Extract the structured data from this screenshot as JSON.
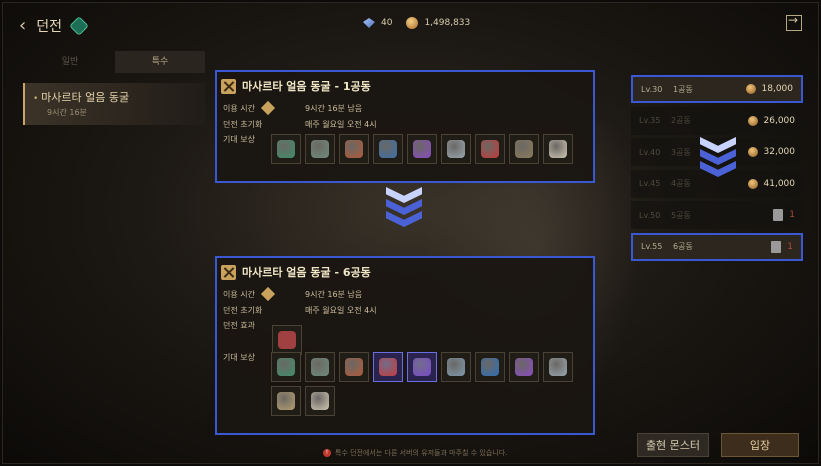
{
  "header": {
    "title": "던전",
    "gem_count": "40",
    "coin_count": "1,498,833"
  },
  "tabs": [
    {
      "label": "일반",
      "active": false
    },
    {
      "label": "특수",
      "active": true
    }
  ],
  "dungeon_list": [
    {
      "name": "마사르타 얼음 동굴",
      "time": "9시간 16분"
    }
  ],
  "panel1": {
    "title": "마사르타 얼음 동굴 - 1공동",
    "rows": [
      {
        "label": "이용 시간",
        "value": "9시간 16분 남음"
      },
      {
        "label": "던전 초기화",
        "value": "매주 월요일 오전 4시"
      }
    ],
    "reward_label": "기대 보상",
    "rewards": [
      {
        "icon": "exp-icon",
        "color": "#3f8f6a"
      },
      {
        "icon": "crossed-swords-icon",
        "color": "#6f8c7a"
      },
      {
        "icon": "rune-icon",
        "color": "#b05a3a"
      },
      {
        "icon": "map-scroll-icon",
        "color": "#3b6fa8"
      },
      {
        "icon": "dagger-icon",
        "color": "#8a4bc0"
      },
      {
        "icon": "pouch-icon",
        "color": "#9aa7b0"
      },
      {
        "icon": "red-emblem-icon",
        "color": "#c43a3a"
      },
      {
        "icon": "gear-medal-icon",
        "color": "#8a7a5a"
      },
      {
        "icon": "ticket-v-icon",
        "color": "#cfc7b5"
      }
    ]
  },
  "panel2": {
    "title": "마사르타 얼음 동굴 - 6공동",
    "rows": [
      {
        "label": "이용 시간",
        "value": "9시간 16분 남음"
      },
      {
        "label": "던전 초기화",
        "value": "매주 월요일 오전 4시"
      }
    ],
    "effect_label": "던전 효과",
    "reward_label": "기대 보상",
    "rewards": [
      {
        "icon": "exp-icon",
        "color": "#3f8f6a",
        "sel": false
      },
      {
        "icon": "crossed-swords-icon",
        "color": "#6f8c7a",
        "sel": false
      },
      {
        "icon": "rune-icon",
        "color": "#b05a3a",
        "sel": false
      },
      {
        "icon": "red-emblem-icon",
        "color": "#c43a3a",
        "sel": true
      },
      {
        "icon": "purple-crystal-icon",
        "color": "#7a4bc8",
        "sel": true
      },
      {
        "icon": "ring-icon",
        "color": "#7f9bb0",
        "sel": false
      },
      {
        "icon": "blue-orb-icon",
        "color": "#2e6fb8",
        "sel": false
      },
      {
        "icon": "dagger-icon",
        "color": "#8a4bc0",
        "sel": false
      },
      {
        "icon": "pouch-icon",
        "color": "#9aa7b0",
        "sel": false
      },
      {
        "icon": "bone-icon",
        "color": "#b8a070",
        "sel": false
      },
      {
        "icon": "ticket-vi-icon",
        "color": "#cfc7b5",
        "sel": false
      }
    ]
  },
  "floors": [
    {
      "lv": "Lv.30",
      "name": "1공동",
      "cost": "18,000",
      "type": "coin",
      "style": "hl"
    },
    {
      "lv": "Lv.35",
      "name": "2공동",
      "cost": "26,000",
      "type": "coin",
      "style": "warm"
    },
    {
      "lv": "Lv.40",
      "name": "3공동",
      "cost": "32,000",
      "type": "coin",
      "style": "warm"
    },
    {
      "lv": "Lv.45",
      "name": "4공동",
      "cost": "41,000",
      "type": "coin",
      "style": "warm"
    },
    {
      "lv": "Lv.50",
      "name": "5공동",
      "cost": "1",
      "type": "ticket",
      "style": ""
    },
    {
      "lv": "Lv.55",
      "name": "6공동",
      "cost": "1",
      "type": "ticket",
      "style": "hl"
    }
  ],
  "buttons": {
    "monster": "출현 몬스터",
    "enter": "입장"
  },
  "notice": "특수 던전에서는 다른 서버의 유저들과 마주칠 수 있습니다."
}
